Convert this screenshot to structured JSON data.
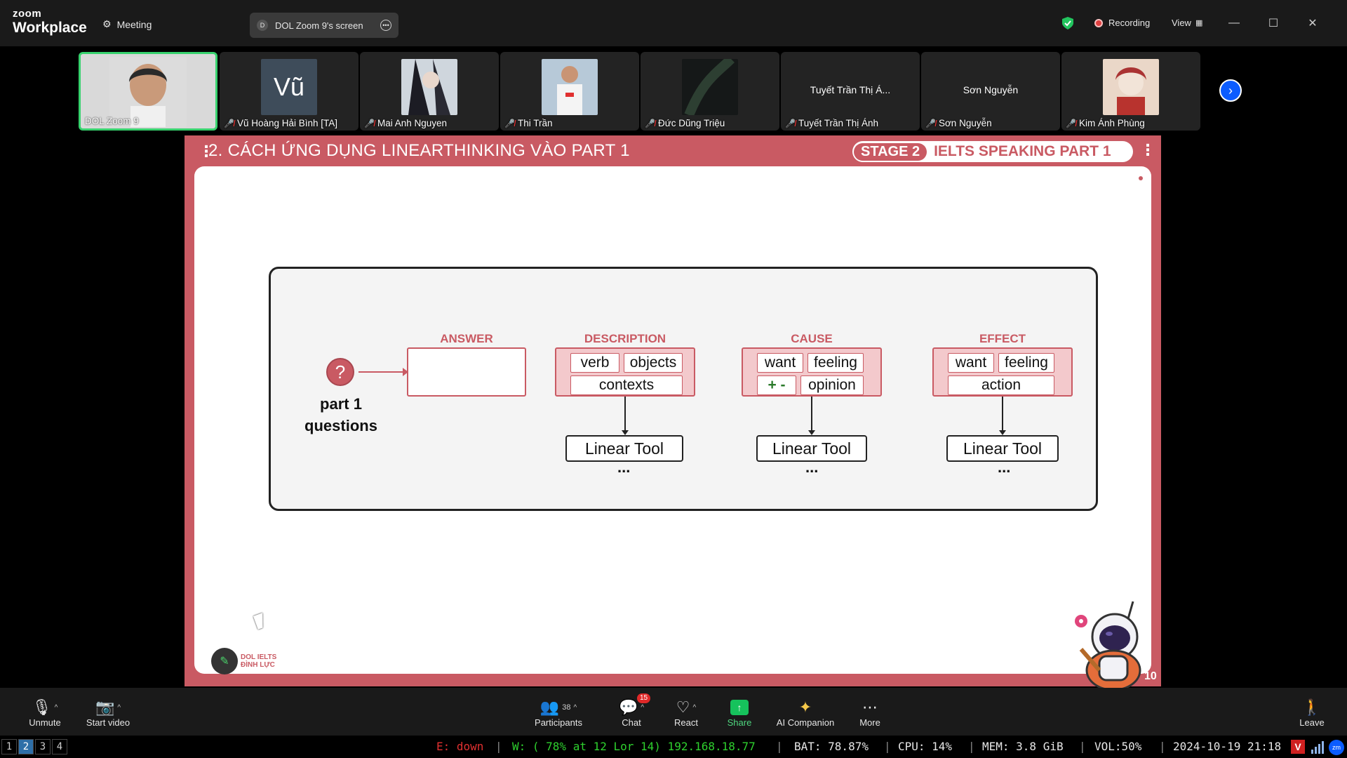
{
  "titlebar": {
    "logo_top": "zoom",
    "logo_bottom": "Workplace",
    "meeting_label": "Meeting",
    "screen_label": "DOL Zoom 9's screen",
    "screen_initial": "D",
    "recording_label": "Recording",
    "view_label": "View"
  },
  "participants_strip": [
    {
      "name": "DOL Zoom 9",
      "muted": false,
      "active": true,
      "display": "video"
    },
    {
      "name": "Vũ Hoàng Hải Bình [TA]",
      "muted": true,
      "display": "initial",
      "initial": "Vũ"
    },
    {
      "name": "Mai Anh Nguyen",
      "muted": true,
      "display": "image"
    },
    {
      "name": "Thi Trần",
      "muted": true,
      "display": "image"
    },
    {
      "name": "Đức Dũng Triệu",
      "muted": true,
      "display": "image"
    },
    {
      "name": "Tuyết Trần Thị Ánh",
      "muted": true,
      "display": "text",
      "center_text": "Tuyết Trần Thị Á..."
    },
    {
      "name": "Sơn Nguyễn",
      "muted": true,
      "display": "text",
      "center_text": "Sơn Nguyễn"
    },
    {
      "name": "Kim Ánh Phùng",
      "muted": true,
      "display": "image"
    }
  ],
  "slide": {
    "title": "2. CÁCH ỨNG DỤNG LINEARTHINKING VÀO PART 1",
    "stage_pill": "STAGE 2",
    "stage_text": "IELTS SPEAKING PART 1",
    "page_number": "10",
    "question_mark": "?",
    "question_label_1": "part 1",
    "question_label_2": "questions",
    "answer_label": "ANSWER",
    "description": {
      "label": "DESCRIPTION",
      "chips": [
        "verb",
        "objects",
        "contexts"
      ],
      "tool": "Linear Tool",
      "more": "..."
    },
    "cause": {
      "label": "CAUSE",
      "chips": [
        "want",
        "feeling",
        "+ -",
        "opinion"
      ],
      "tool": "Linear Tool",
      "more": "..."
    },
    "effect": {
      "label": "EFFECT",
      "chips": [
        "want",
        "feeling",
        "action"
      ],
      "tool": "Linear Tool",
      "more": "..."
    },
    "brand_text_1": "DOL IELTS",
    "brand_text_2": "ĐÌNH LỰC"
  },
  "toolbar": {
    "unmute": "Unmute",
    "start_video": "Start video",
    "participants": "Participants",
    "participants_count": "38",
    "chat": "Chat",
    "chat_badge": "15",
    "react": "React",
    "share": "Share",
    "ai_companion": "AI Companion",
    "more": "More",
    "leave": "Leave"
  },
  "statusbar": {
    "workspaces": [
      "1",
      "2",
      "3",
      "4"
    ],
    "active_workspace": "2",
    "ethernet": "E: down",
    "wifi": "W: ( 78% at 12 Lor 14) 192.168.18.77",
    "battery": "BAT: 78.87%",
    "cpu": "CPU: 14%",
    "mem": "MEM: 3.8 GiB",
    "vol": "VOL:50%",
    "datetime": "2024-10-19 21:18",
    "tray_v": "V",
    "tray_zm": "zm"
  },
  "colors": {
    "slide_accent": "#c95a63",
    "active_border": "#38d26e",
    "share_green": "#16c25c",
    "zoom_blue": "#0b5cff"
  }
}
